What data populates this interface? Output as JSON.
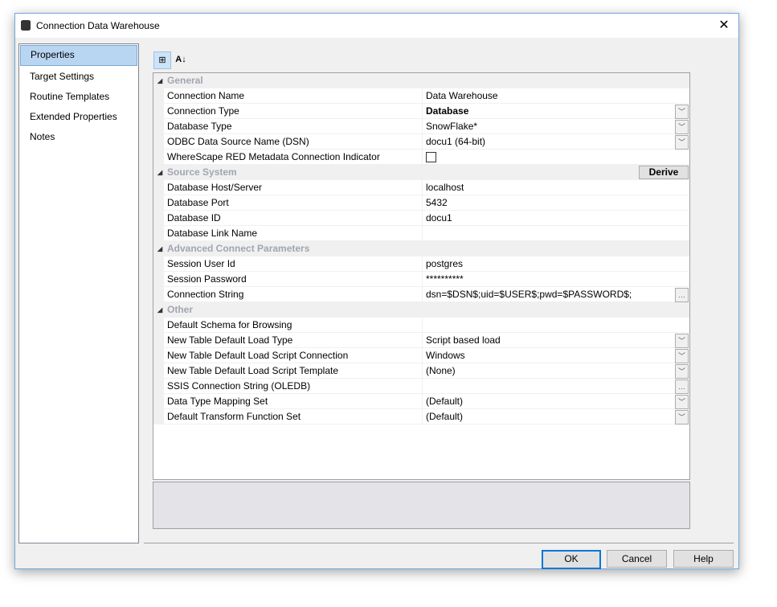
{
  "window": {
    "title": "Connection Data Warehouse"
  },
  "nav": [
    "Properties",
    "Target Settings",
    "Routine Templates",
    "Extended Properties",
    "Notes"
  ],
  "toolbar": {
    "categorized": "⊞",
    "alpha": "A↓"
  },
  "grid": [
    {
      "type": "cat",
      "label": "General"
    },
    {
      "type": "prop",
      "label": "Connection Name",
      "value": "Data Warehouse"
    },
    {
      "type": "prop",
      "label": "Connection Type",
      "value": "Database",
      "bold": true,
      "ctrl": "dd"
    },
    {
      "type": "prop",
      "label": "Database Type",
      "value": "SnowFlake*",
      "ctrl": "dd"
    },
    {
      "type": "prop",
      "label": "ODBC Data Source Name (DSN)",
      "value": "docu1 (64-bit)",
      "ctrl": "dd"
    },
    {
      "type": "prop",
      "label": "WhereScape RED Metadata Connection Indicator",
      "value": "",
      "ctrl": "chk"
    },
    {
      "type": "cat",
      "label": "Source System",
      "button": "Derive"
    },
    {
      "type": "prop",
      "label": "Database Host/Server",
      "value": "localhost"
    },
    {
      "type": "prop",
      "label": "Database Port",
      "value": "5432"
    },
    {
      "type": "prop",
      "label": "Database ID",
      "value": "docu1"
    },
    {
      "type": "prop",
      "label": "Database Link Name",
      "value": ""
    },
    {
      "type": "cat",
      "label": "Advanced Connect Parameters"
    },
    {
      "type": "prop",
      "label": "Session User Id",
      "value": "postgres"
    },
    {
      "type": "prop",
      "label": "Session Password",
      "value": "**********"
    },
    {
      "type": "prop",
      "label": "Connection String",
      "value": "dsn=$DSN$;uid=$USER$;pwd=$PASSWORD$;",
      "ctrl": "ell"
    },
    {
      "type": "cat",
      "label": "Other"
    },
    {
      "type": "prop",
      "label": "Default Schema for Browsing",
      "value": ""
    },
    {
      "type": "prop",
      "label": "New Table Default Load Type",
      "value": "Script based load",
      "ctrl": "dd"
    },
    {
      "type": "prop",
      "label": "New Table Default Load Script Connection",
      "value": "Windows",
      "ctrl": "dd"
    },
    {
      "type": "prop",
      "label": "New Table Default Load Script Template",
      "value": "(None)",
      "ctrl": "dd"
    },
    {
      "type": "prop",
      "label": "SSIS Connection String (OLEDB)",
      "value": "",
      "ctrl": "ell"
    },
    {
      "type": "prop",
      "label": "Data Type Mapping Set",
      "value": "(Default)",
      "ctrl": "dd"
    },
    {
      "type": "prop",
      "label": "Default Transform Function Set",
      "value": "(Default)",
      "ctrl": "dd"
    }
  ],
  "buttons": {
    "ok": "OK",
    "cancel": "Cancel",
    "help": "Help"
  }
}
